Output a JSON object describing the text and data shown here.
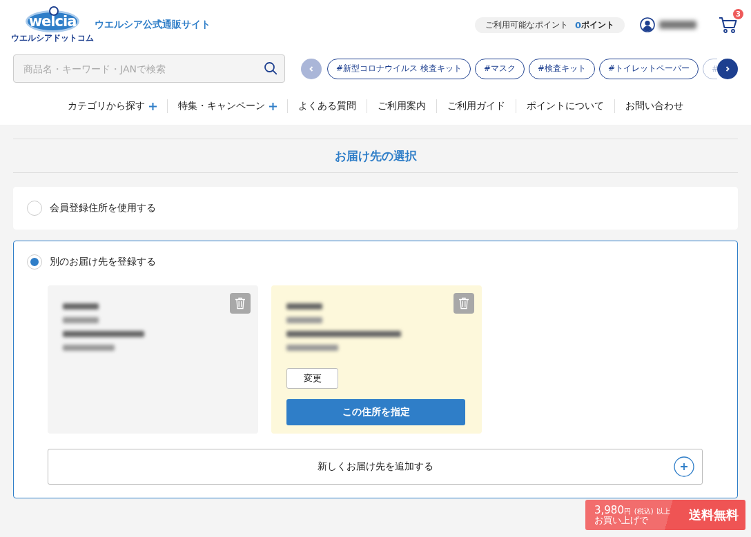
{
  "site": {
    "logo_text": "welcia",
    "logo_subtext": "ウエルシアドットコム",
    "tagline": "ウエルシア公式通販サイト"
  },
  "points": {
    "label": "ご利用可能なポイント",
    "value": "0",
    "unit": "ポイント"
  },
  "cart": {
    "count": "3"
  },
  "search": {
    "placeholder": "商品名・キーワード・JANで検索"
  },
  "tags": [
    {
      "label": "#新型コロナウイルス 検査キット"
    },
    {
      "label": "#マスク"
    },
    {
      "label": "#検査キット"
    },
    {
      "label": "#トイレットペーパー"
    },
    {
      "label": "#"
    }
  ],
  "nav": [
    {
      "label": "カテゴリから探す",
      "expandable": true
    },
    {
      "label": "特集・キャンペーン",
      "expandable": true
    },
    {
      "label": "よくある質問",
      "expandable": false
    },
    {
      "label": "ご利用案内",
      "expandable": false
    },
    {
      "label": "ご利用ガイド",
      "expandable": false
    },
    {
      "label": "ポイントについて",
      "expandable": false
    },
    {
      "label": "お問い合わせ",
      "expandable": false
    }
  ],
  "page_title": "お届け先の選択",
  "options": [
    {
      "label": "会員登録住所を使用する",
      "selected": false
    },
    {
      "label": "別のお届け先を登録する",
      "selected": true
    }
  ],
  "addresses": [
    {
      "selected": false
    },
    {
      "selected": true
    }
  ],
  "address_actions": {
    "change": "変更",
    "select": "この住所を指定"
  },
  "add_address": "新しくお届け先を追加する",
  "shipping_banner": {
    "amount": "3,980",
    "currency": "円",
    "tax": "(税込)",
    "suffix": "以上",
    "line2": "お買い上げで",
    "headline": "送料無料"
  }
}
